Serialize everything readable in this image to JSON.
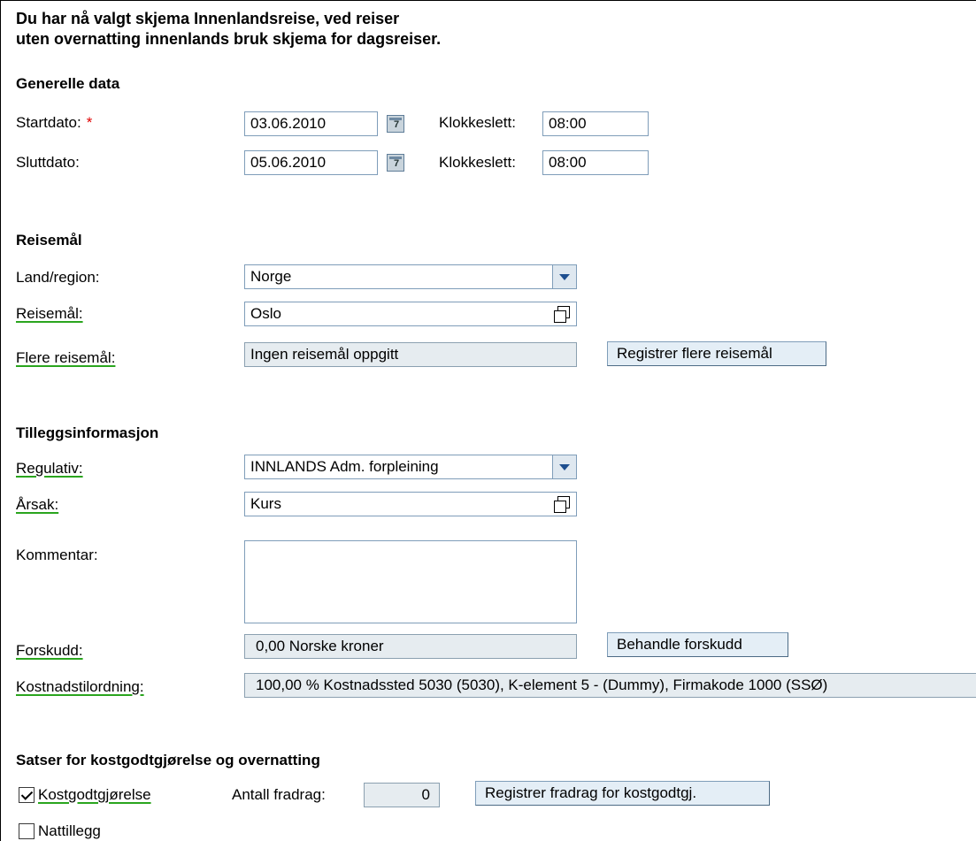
{
  "intro": {
    "line1": "Du har nå valgt skjema Innenlandsreise, ved reiser",
    "line2": "uten overnatting innenlands bruk skjema for dagsreiser."
  },
  "general": {
    "heading": "Generelle data",
    "start_label": "Startdato:",
    "required_marker": "*",
    "start_date": "03.06.2010",
    "end_label": "Sluttdato:",
    "end_date": "05.06.2010",
    "time_label": "Klokkeslett:",
    "start_time": "08:00",
    "end_time": "08:00"
  },
  "destination": {
    "heading": "Reisemål",
    "country_label": "Land/region:",
    "country_value": "Norge",
    "destination_label": "Reisemål:",
    "destination_value": "Oslo",
    "more_label": "Flere reisemål:",
    "more_value": "Ingen reisemål oppgitt",
    "more_button": "Registrer flere reisemål"
  },
  "additional": {
    "heading": "Tilleggsinformasjon",
    "regulation_label": "Regulativ:",
    "regulation_value": "INNLANDS Adm. forpleining",
    "reason_label": "Årsak:",
    "reason_value": "Kurs",
    "comment_label": "Kommentar:",
    "comment_value": "",
    "advance_label": "Forskudd:",
    "advance_value": "0,00 Norske kroner",
    "advance_button": "Behandle forskudd",
    "cost_label": "Kostnadstilordning:",
    "cost_value": "100,00 % Kostnadssted 5030 (5030), K-element 5 - (Dummy), Firmakode 1000 (SSØ)"
  },
  "rates": {
    "heading": "Satser for kostgodtgjørelse og overnatting",
    "meal_label": "Kostgodtgjørelse",
    "meal_checked": true,
    "deductions_label": "Antall fradrag:",
    "deductions_value": "0",
    "deductions_button": "Registrer fradrag for kostgodtgj.",
    "night_label": "Nattillegg",
    "night_checked": false
  }
}
